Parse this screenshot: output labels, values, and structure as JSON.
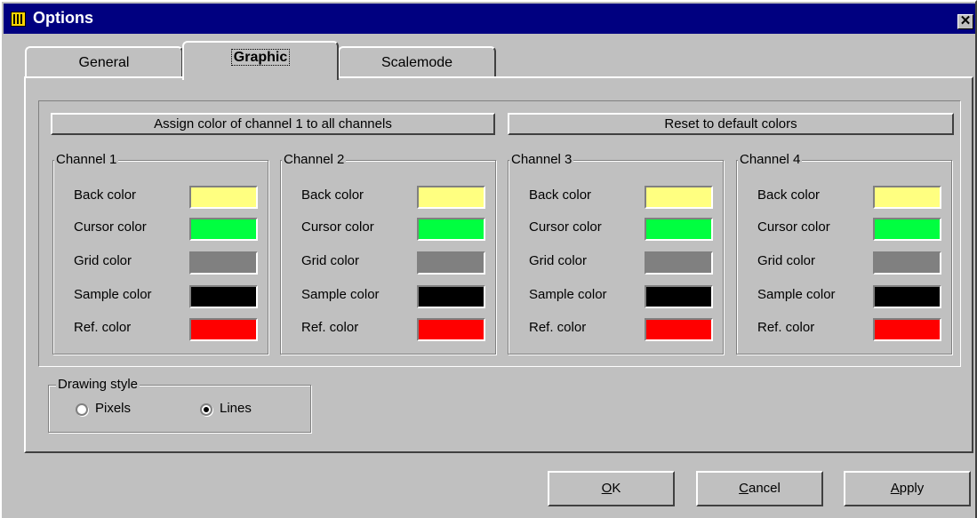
{
  "window": {
    "title": "Options",
    "close_glyph": "✕"
  },
  "tabs": [
    {
      "label": "General",
      "active": false
    },
    {
      "label": "Graphic",
      "active": true
    },
    {
      "label": "Scalemode",
      "active": false
    }
  ],
  "graphic": {
    "assign_button": "Assign color of channel 1 to all channels",
    "reset_button": "Reset to default colors",
    "row_labels": [
      "Back color",
      "Cursor color",
      "Grid color",
      "Sample color",
      "Ref. color"
    ],
    "channels": [
      {
        "title": "Channel 1",
        "colors": [
          "#ffff80",
          "#00ff40",
          "#808080",
          "#000000",
          "#ff0000"
        ]
      },
      {
        "title": "Channel 2",
        "colors": [
          "#ffff80",
          "#00ff40",
          "#808080",
          "#000000",
          "#ff0000"
        ]
      },
      {
        "title": "Channel 3",
        "colors": [
          "#ffff80",
          "#00ff40",
          "#808080",
          "#000000",
          "#ff0000"
        ]
      },
      {
        "title": "Channel 4",
        "colors": [
          "#ffff80",
          "#00ff40",
          "#808080",
          "#000000",
          "#ff0000"
        ]
      }
    ],
    "drawing_style": {
      "title": "Drawing style",
      "options": [
        {
          "label": "Pixels",
          "checked": false
        },
        {
          "label": "Lines",
          "checked": true
        }
      ]
    }
  },
  "buttons": {
    "ok": {
      "mnemonic": "O",
      "rest": "K"
    },
    "cancel": {
      "mnemonic": "C",
      "rest": "ancel"
    },
    "apply": {
      "mnemonic": "A",
      "rest": "pply"
    }
  },
  "icons": {
    "app": "oscilloscope-app-icon",
    "close": "close-icon"
  }
}
